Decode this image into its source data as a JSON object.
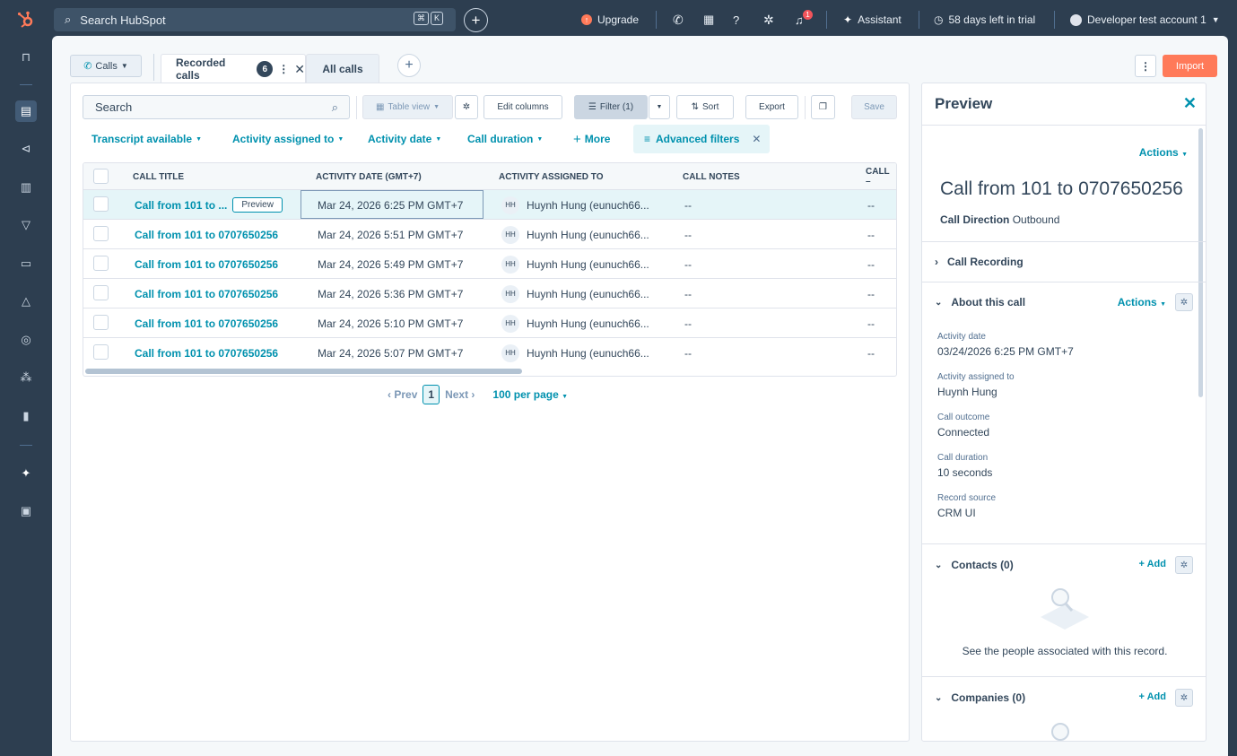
{
  "topbar": {
    "search_placeholder": "Search HubSpot",
    "kbd": [
      "⌘",
      "K"
    ],
    "upgrade": "Upgrade",
    "notification_count": "1",
    "assistant": "Assistant",
    "trial": "58 days left in trial",
    "account": "Developer test account 1"
  },
  "toolbar": {
    "object_label": "Calls",
    "tab_active": "Recorded calls",
    "tab_count": "6",
    "tab_all": "All calls",
    "more": "⋮",
    "import": "Import"
  },
  "filters": {
    "search_placeholder": "Search",
    "table_view": "Table view",
    "edit_columns": "Edit columns",
    "filter": "Filter (1)",
    "sort": "Sort",
    "export": "Export",
    "save": "Save",
    "quick": [
      "Transcript available",
      "Activity assigned to",
      "Activity date",
      "Call duration"
    ],
    "more": "More",
    "advanced": "Advanced filters"
  },
  "table": {
    "columns": [
      "CALL TITLE",
      "ACTIVITY DATE (GMT+7)",
      "ACTIVITY ASSIGNED TO",
      "CALL NOTES",
      "CALL –"
    ],
    "preview_chip": "Preview",
    "rows": [
      {
        "title": "Call from 101 to ...",
        "date": "Mar 24, 2026 6:25 PM GMT+7",
        "initials": "HH",
        "owner": "Huynh Hung (eunuch66...",
        "notes": "--",
        "extra": "--"
      },
      {
        "title": "Call from 101 to 0707650256",
        "date": "Mar 24, 2026 5:51 PM GMT+7",
        "initials": "HH",
        "owner": "Huynh Hung (eunuch66...",
        "notes": "--",
        "extra": "--"
      },
      {
        "title": "Call from 101 to 0707650256",
        "date": "Mar 24, 2026 5:49 PM GMT+7",
        "initials": "HH",
        "owner": "Huynh Hung (eunuch66...",
        "notes": "--",
        "extra": "--"
      },
      {
        "title": "Call from 101 to 0707650256",
        "date": "Mar 24, 2026 5:36 PM GMT+7",
        "initials": "HH",
        "owner": "Huynh Hung (eunuch66...",
        "notes": "--",
        "extra": "--"
      },
      {
        "title": "Call from 101 to 0707650256",
        "date": "Mar 24, 2026 5:10 PM GMT+7",
        "initials": "HH",
        "owner": "Huynh Hung (eunuch66...",
        "notes": "--",
        "extra": "--"
      },
      {
        "title": "Call from 101 to 0707650256",
        "date": "Mar 24, 2026 5:07 PM GMT+7",
        "initials": "HH",
        "owner": "Huynh Hung (eunuch66...",
        "notes": "--",
        "extra": "--"
      }
    ]
  },
  "pagination": {
    "prev": "Prev",
    "page": "1",
    "next": "Next",
    "per_page": "100 per page"
  },
  "preview": {
    "heading": "Preview",
    "actions": "Actions",
    "title": "Call from 101 to 0707650256",
    "direction_label": "Call Direction",
    "direction_value": "Outbound",
    "sections": {
      "recording": "Call Recording",
      "about": "About this call",
      "contacts": "Contacts (0)",
      "companies": "Companies (0)"
    },
    "add": "Add",
    "properties": [
      {
        "label": "Activity date",
        "value": "03/24/2026 6:25 PM GMT+7"
      },
      {
        "label": "Activity assigned to",
        "value": "Huynh Hung"
      },
      {
        "label": "Call outcome",
        "value": "Connected"
      },
      {
        "label": "Call duration",
        "value": "10 seconds"
      },
      {
        "label": "Record source",
        "value": "CRM UI"
      }
    ],
    "contacts_empty": "See the people associated with this record."
  },
  "colors": {
    "accent": "#0091ae",
    "brand": "#ff7a59",
    "nav": "#2d3e50"
  }
}
